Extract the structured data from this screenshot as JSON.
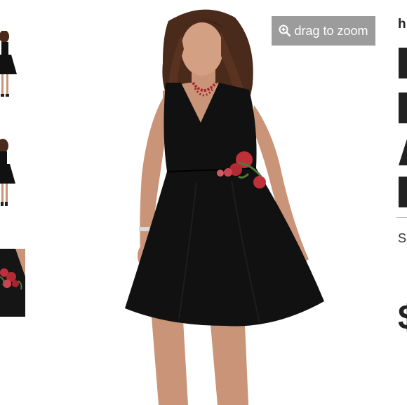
{
  "zoom": {
    "label": "drag to zoom",
    "icon": "zoom-in-icon",
    "background": "#9c9c9c"
  },
  "thumbnails": [
    {
      "name": "thumbnail-front-full"
    },
    {
      "name": "thumbnail-side-full"
    },
    {
      "name": "thumbnail-rose-detail"
    }
  ],
  "product": {
    "breadcrumb_fragment": "h",
    "title_fragments": [
      "",
      "",
      "",
      ""
    ],
    "detail_fragment": "S",
    "price_fragment": "$"
  },
  "colors": {
    "dress": "#111111",
    "rose": "#c0303a",
    "skin": "#c99478",
    "hair": "#4a2a1a"
  }
}
